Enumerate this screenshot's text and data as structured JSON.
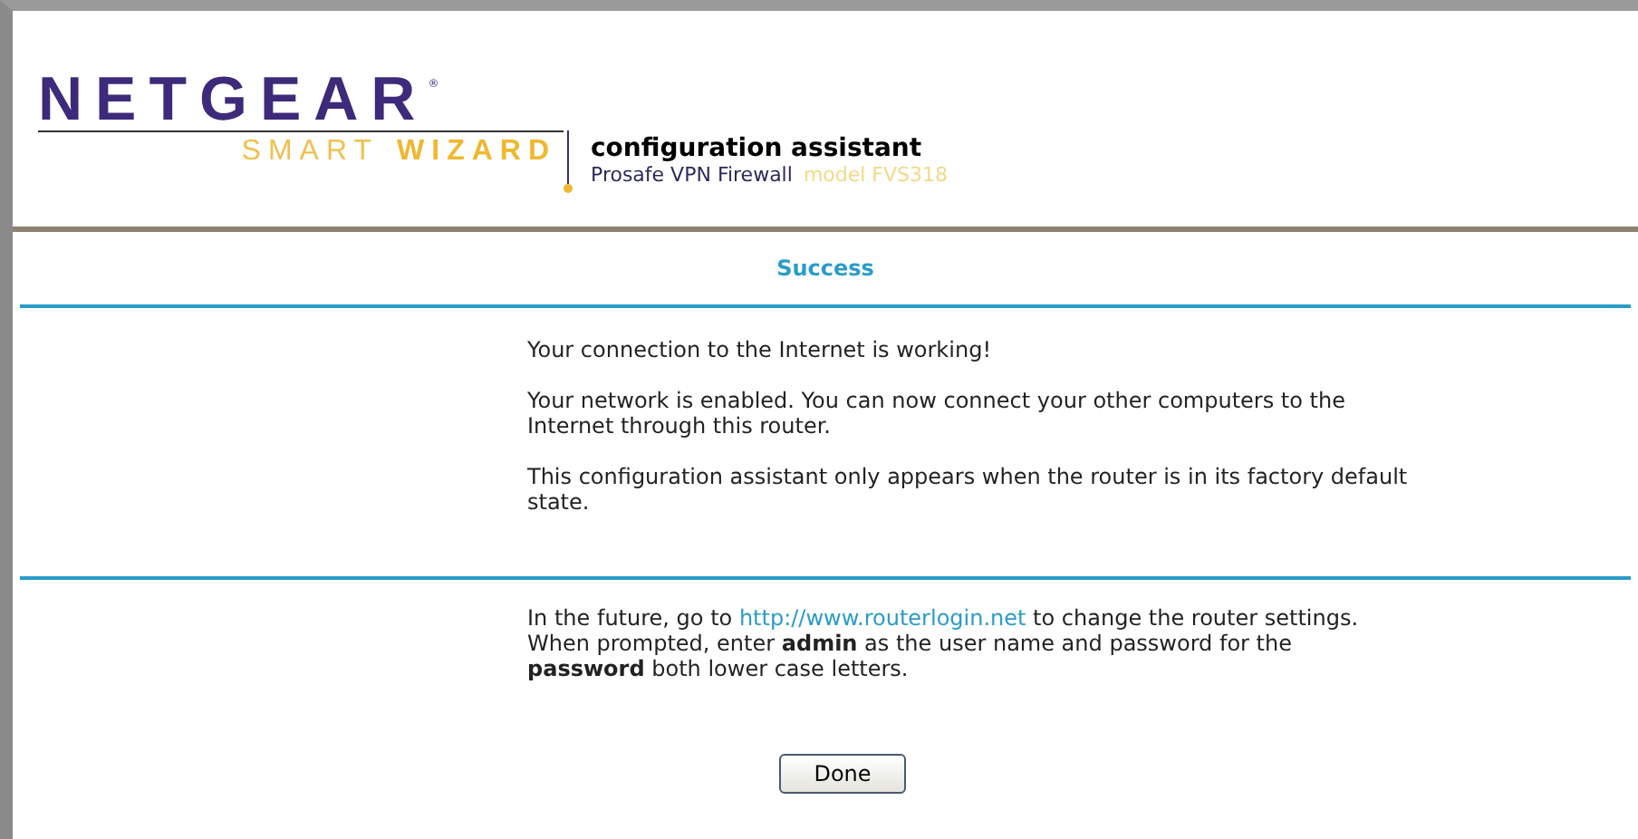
{
  "header": {
    "brand": "NETGEAR",
    "brand_mark": "®",
    "sub_light": "SMART",
    "sub_bold": "WIZARD",
    "title": "configuration assistant",
    "product": "Prosafe VPN Firewall",
    "model": "model FVS318"
  },
  "section_title": "Success",
  "messages": [
    "Your connection to the Internet is working!",
    "Your network is enabled. You can now connect your other computers to the Internet through this router.",
    "This configuration assistant only appears when the router is in its factory default state."
  ],
  "footer": {
    "before_link": "In the future, go to ",
    "link": "http://www.routerlogin.net",
    "after_link": " to change the router settings.",
    "note": "When prompted, enter **admin** as the user name and password for the **password** both lower case letters."
  },
  "button": "Done"
}
